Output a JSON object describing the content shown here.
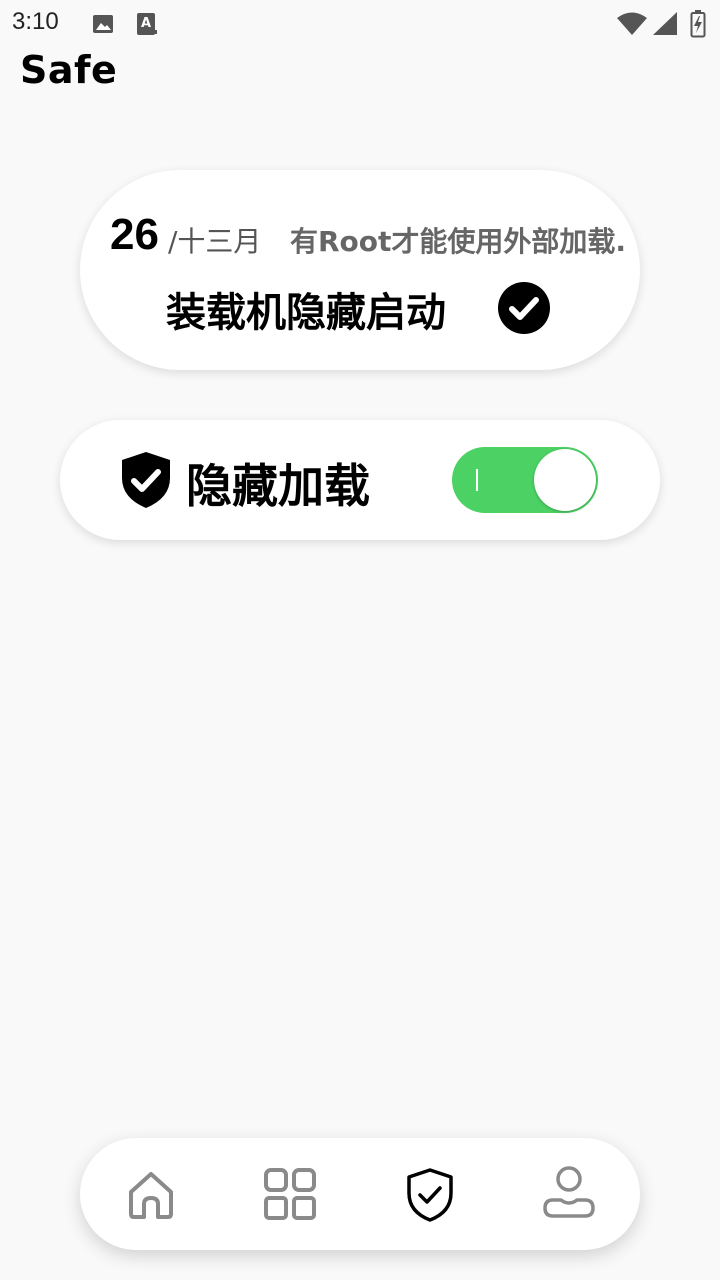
{
  "status_bar": {
    "time": "3:10",
    "icons": [
      "image-icon",
      "text-input-icon",
      "wifi-icon",
      "signal-icon",
      "battery-charging-icon"
    ]
  },
  "app": {
    "title": "Safe"
  },
  "date_card": {
    "day": "26",
    "month": "/十三月",
    "note": "有Root才能使用外部加载.",
    "launch_text": "装载机隐藏启动",
    "check_icon": "check-circle-icon"
  },
  "hide_card": {
    "label": "隐藏加载",
    "icon": "shield-check-icon",
    "toggle_on": true,
    "toggle_color": "#4cd264"
  },
  "bottom_nav": {
    "items": [
      {
        "icon": "home-icon",
        "active": false
      },
      {
        "icon": "grid-icon",
        "active": false
      },
      {
        "icon": "shield-check-icon",
        "active": true
      },
      {
        "icon": "user-icon",
        "active": false
      }
    ]
  }
}
